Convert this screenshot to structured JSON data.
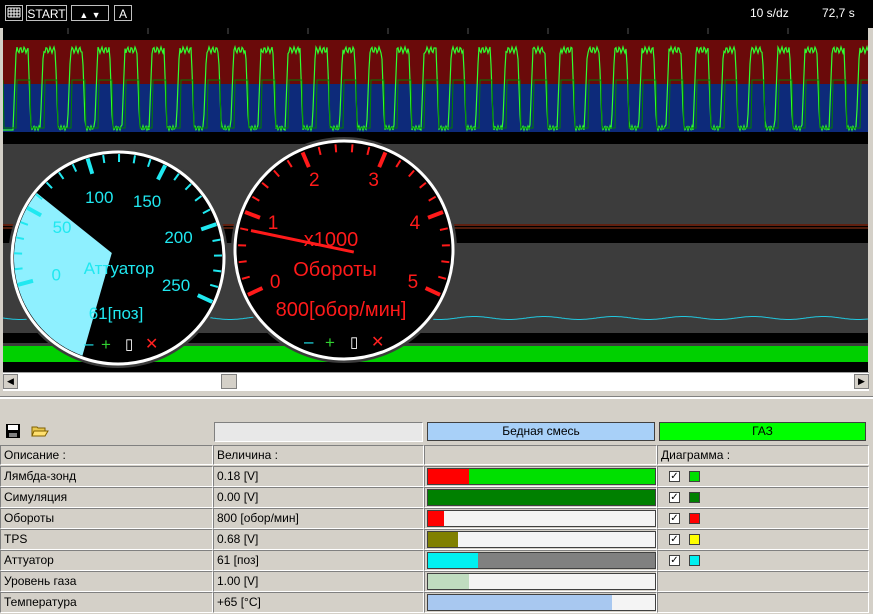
{
  "toolbar": {
    "grid_icon": "grid-icon",
    "start_label": "START",
    "up_label": "▲",
    "down_label": "▼",
    "auto_label": "A",
    "timebase": "10 s/dz",
    "elapsed": "72,7 s"
  },
  "gauges": {
    "actuator": {
      "title": "Аттуатор",
      "value_text": "61[поз]",
      "ticks": [
        "0",
        "50",
        "100",
        "150",
        "200",
        "250"
      ],
      "value": 61,
      "color": "#20e8f0",
      "minus": "–",
      "plus": "+",
      "toggle": "▯",
      "close": "✕"
    },
    "rpm": {
      "title": "Обороты",
      "multiplier": "x1000",
      "value_text": "800[обор/мин]",
      "ticks": [
        "0",
        "1",
        "2",
        "3",
        "4",
        "5"
      ],
      "value": 800,
      "color": "#ff1a1a",
      "minus": "–",
      "plus": "+",
      "toggle": "▯",
      "close": "✕"
    }
  },
  "panel": {
    "save_icon": "save-icon",
    "open_icon": "folder-open-icon",
    "legend_lean": "Бедная смесь",
    "legend_lean_color": "#a8d0f8",
    "legend_gas": "ГАЗ",
    "legend_gas_color": "#00ff00",
    "headers": {
      "description": "Описание :",
      "value": "Величина :",
      "diagram": "Диаграмма :"
    },
    "rows": [
      {
        "name": "Лямбда-зонд",
        "value": "0.18 [V]",
        "fill_fraction": 0.18,
        "fill_color": "#ff0000",
        "track_color": "#00e000",
        "checked": true,
        "checkmark": "✓",
        "swatch": "#00e000"
      },
      {
        "name": "Симуляция",
        "value": "0.00 [V]",
        "fill_fraction": 0.0,
        "fill_color": "#008000",
        "track_color": "#008000",
        "checked": true,
        "checkmark": "✓",
        "swatch": "#008000"
      },
      {
        "name": "Обороты",
        "value": "800 [обор/мин]",
        "fill_fraction": 0.07,
        "fill_color": "#ff0000",
        "track_color": "#f4f4f4",
        "checked": true,
        "checkmark": "✓",
        "swatch": "#ff0000"
      },
      {
        "name": "TPS",
        "value": "0.68 [V]",
        "fill_fraction": 0.13,
        "fill_color": "#808000",
        "track_color": "#f4f4f4",
        "checked": true,
        "checkmark": "✓",
        "swatch": "#ffff00"
      },
      {
        "name": "Аттуатор",
        "value": "61 [поз]",
        "fill_fraction": 0.22,
        "fill_color": "#00f0f0",
        "track_color": "#808080",
        "checked": true,
        "checkmark": "✓",
        "swatch": "#00f0f0"
      },
      {
        "name": "Уровень газа",
        "value": "1.00 [V]",
        "fill_fraction": 0.18,
        "fill_color": "#c0dcc0",
        "track_color": "#f4f4f4",
        "checked": false,
        "checkmark": "",
        "swatch": ""
      },
      {
        "name": "Температура",
        "value": "+65 [°C]",
        "fill_fraction": 0.81,
        "fill_color": "#a8c8f0",
        "track_color": "#f4f4f4",
        "checked": false,
        "checkmark": "",
        "swatch": ""
      }
    ]
  }
}
